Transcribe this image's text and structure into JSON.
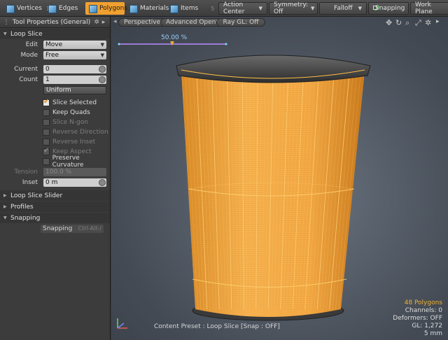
{
  "toolbar": {
    "tabs": [
      {
        "label": "Vertices",
        "num": "1"
      },
      {
        "label": "Edges",
        "num": "2"
      },
      {
        "label": "Polygons",
        "num": ""
      },
      {
        "label": "Materials",
        "num": ""
      },
      {
        "label": "Items",
        "num": "5"
      }
    ],
    "action_center": "Action Center",
    "symmetry": "Symmetry: Off",
    "falloff": "Falloff",
    "snapping": "Snapping",
    "work_plane": "Work Plane"
  },
  "panel": {
    "title": "Tool Properties (General)",
    "section_loop_slice": "Loop Slice",
    "edit_label": "Edit",
    "edit_value": "Move",
    "mode_label": "Mode",
    "mode_value": "Free",
    "current_label": "Current",
    "current_value": "0",
    "count_label": "Count",
    "count_value": "1",
    "uniform_label": "Uniform",
    "checks": [
      {
        "label": "Slice Selected",
        "state": "on"
      },
      {
        "label": "Keep Quads",
        "state": "off"
      },
      {
        "label": "Slice N-gon",
        "state": "dim"
      },
      {
        "label": "Reverse Direction",
        "state": "dim"
      },
      {
        "label": "Reverse Inset",
        "state": "dim"
      },
      {
        "label": "Keep Aspect",
        "state": "dimon"
      },
      {
        "label": "Preserve Curvature",
        "state": "off"
      }
    ],
    "tension_label": "Tension",
    "tension_value": "100.0 %",
    "inset_label": "Inset",
    "inset_value": "0 m",
    "section_slider": "Loop Slice Slider",
    "section_profiles": "Profiles",
    "section_snapping": "Snapping",
    "snapping_btn": "Snapping",
    "snapping_hotkey": "Ctrl-Alt-/"
  },
  "viewport": {
    "perspective": "Perspective",
    "opengl": "Advanced OpenGL",
    "raygl": "Ray GL: Off",
    "slider_value": "50.00 %",
    "preset_text": "Content Preset : Loop Slice  [Snap : OFF]",
    "info_polygons": "48 Polygons",
    "info_channels": "Channels: 0",
    "info_deformers": "Deformers: OFF",
    "info_gl": "GL: 1,272",
    "info_units": "5 mm"
  },
  "colors": {
    "accent": "#f0a030",
    "mesh_fill": "#f2a541",
    "wire": "#ffc04a"
  }
}
